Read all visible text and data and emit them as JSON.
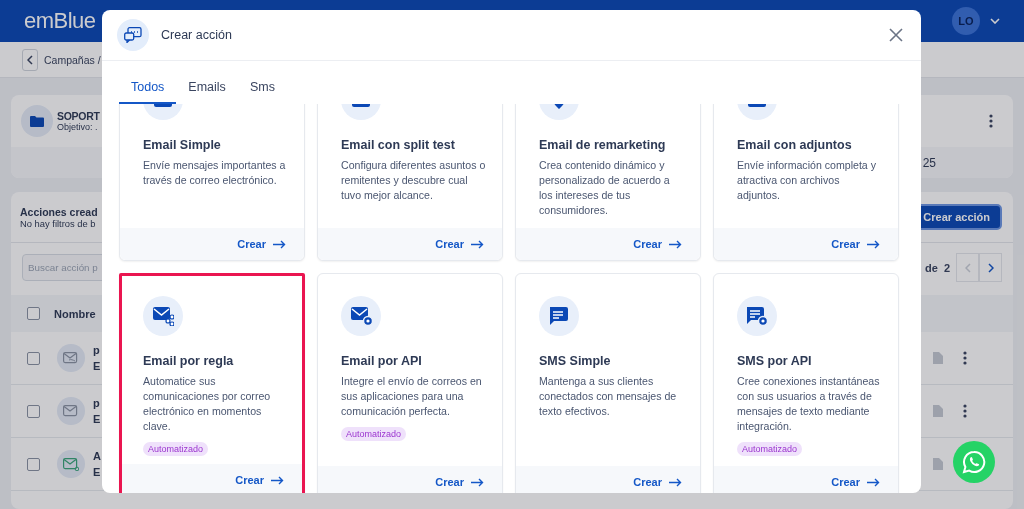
{
  "header": {
    "logo": "emBlue",
    "avatar": "LO"
  },
  "breadcrumb": {
    "text": "Campañas /"
  },
  "campaign": {
    "name": "SOPORT",
    "objective": "Objetivo: .",
    "value": "25"
  },
  "actions_panel": {
    "title": "Acciones cread",
    "subtitle": "No hay filtros de b",
    "create_button": "Crear acción",
    "search": {
      "placeholder": "Buscar acción p"
    },
    "pagination": {
      "of": "de",
      "total": "2"
    },
    "header_row": {
      "checked": false,
      "column": "Nombre"
    },
    "rows": [
      {
        "kind": "hand",
        "name": "p",
        "type": "E",
        "checked": false
      },
      {
        "kind": "mail",
        "name": "p",
        "type": "E",
        "checked": false
      },
      {
        "kind": "rule",
        "name": "A",
        "type": "E",
        "checked": false
      }
    ]
  },
  "modal": {
    "title": "Crear acción",
    "tabs": [
      {
        "label": "Todos",
        "selected": true
      },
      {
        "label": "Emails",
        "selected": false
      },
      {
        "label": "Sms",
        "selected": false
      }
    ],
    "cards": [
      {
        "kind": "mail",
        "title": "Email Simple",
        "description": "Envíe mensajes importantes a través de correo electrónico.",
        "action": "Crear",
        "highlighted": false
      },
      {
        "kind": "split",
        "title": "Email con split test",
        "description": "Configura diferentes asuntos o remitentes y descubre cual tuvo mejor alcance.",
        "action": "Crear",
        "highlighted": false
      },
      {
        "kind": "pin",
        "title": "Email de remarketing",
        "description": "Crea contenido dinámico y personalizado de acuerdo a los intereses de tus consumidores.",
        "action": "Crear",
        "highlighted": false
      },
      {
        "kind": "attach",
        "title": "Email con adjuntos",
        "description": "Envíe información completa y atractiva con archivos adjuntos.",
        "action": "Crear",
        "highlighted": false
      },
      {
        "kind": "rule",
        "title": "Email por regla",
        "description": "Automatice sus comunicaciones por correo electrónico en momentos clave.",
        "badge": "Automatizado",
        "action": "Crear",
        "highlighted": true
      },
      {
        "kind": "api",
        "title": "Email por API",
        "description": "Integre el envío de correos en sus aplicaciones para una comunicación perfecta.",
        "badge": "Automatizado",
        "action": "Crear",
        "highlighted": false
      },
      {
        "kind": "sms",
        "title": "SMS Simple",
        "description": "Mantenga a sus clientes conectados con mensajes de texto efectivos.",
        "action": "Crear",
        "highlighted": false
      },
      {
        "kind": "smsapi",
        "title": "SMS por API",
        "description": "Cree conexiones instantáneas con sus usuarios a través de mensajes de texto mediante integración.",
        "badge": "Automatizado",
        "action": "Crear",
        "highlighted": false
      }
    ]
  }
}
